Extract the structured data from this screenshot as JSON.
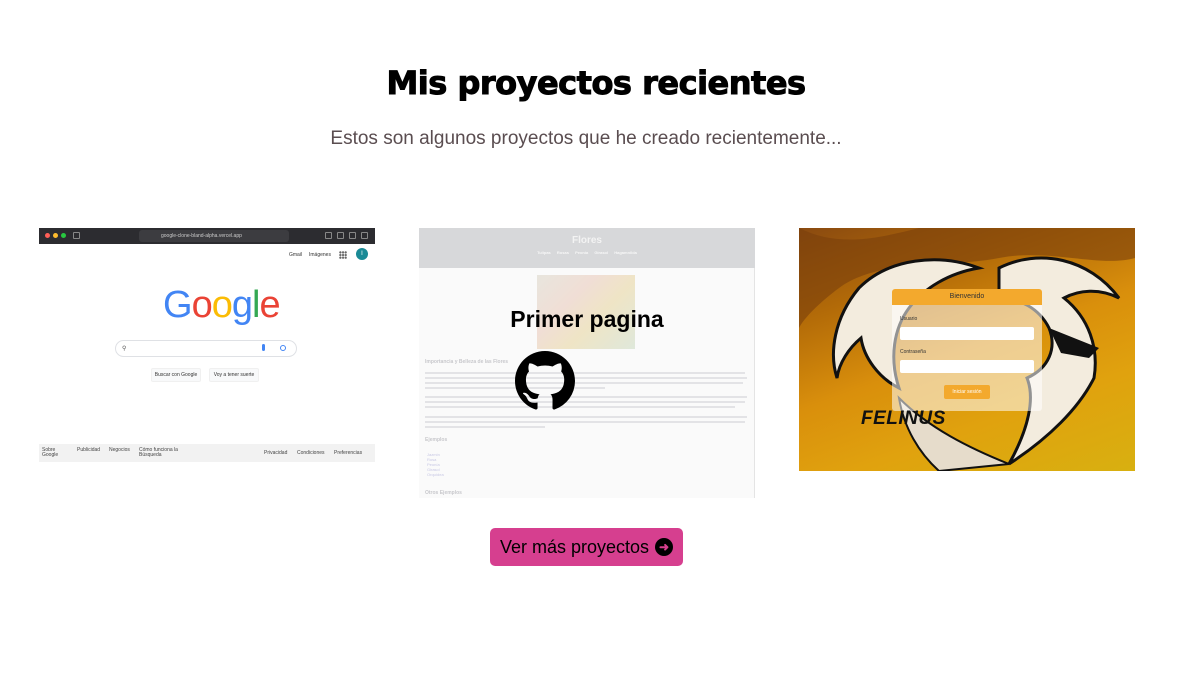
{
  "section": {
    "title": "Mis proyectos recientes",
    "subtitle": "Estos son algunos proyectos que he creado recientemente..."
  },
  "projects": [
    {
      "name": "google-clone",
      "url_bar": "google-clone-bland-alpha.vercel.app",
      "top_links": [
        "Gmail",
        "Imágenes"
      ],
      "avatar_letter": "I",
      "logo_letters": [
        "G",
        "o",
        "o",
        "g",
        "l",
        "e"
      ],
      "logo_colors": [
        "#4285f4",
        "#ea4335",
        "#fbbc05",
        "#4285f4",
        "#34a853",
        "#ea4335"
      ],
      "buttons": [
        "Buscar con Google",
        "Voy a tener suerte"
      ],
      "footer_links": [
        "Sobre Google",
        "Publicidad",
        "Negocios",
        "Cómo funciona la Búsqueda",
        "Privacidad",
        "Condiciones",
        "Preferencias"
      ]
    },
    {
      "name": "flores",
      "brand": "Flores",
      "nav": [
        "Tulipas",
        "Rosas",
        "Peonía",
        "Girasol",
        "Hagamnilda"
      ],
      "overlay_title": "Primer pagina",
      "headings": [
        "Importancia y Belleza de las Flores",
        "Ejemplos",
        "Otros Ejemplos"
      ],
      "list": [
        "Jazmín",
        "Rosa",
        "Peonía",
        "Girasol",
        "Orquídea"
      ],
      "link_icon": "github-icon"
    },
    {
      "name": "felinus",
      "login_title": "Bienvenido",
      "user_label": "Usuario",
      "password_label": "Contraseña",
      "submit_label": "Iniciar sesión",
      "brand": "FELINUS"
    }
  ],
  "cta": {
    "label": "Ver más proyectos",
    "icon": "arrow-right-circle-icon",
    "color": "#d63f8f"
  }
}
